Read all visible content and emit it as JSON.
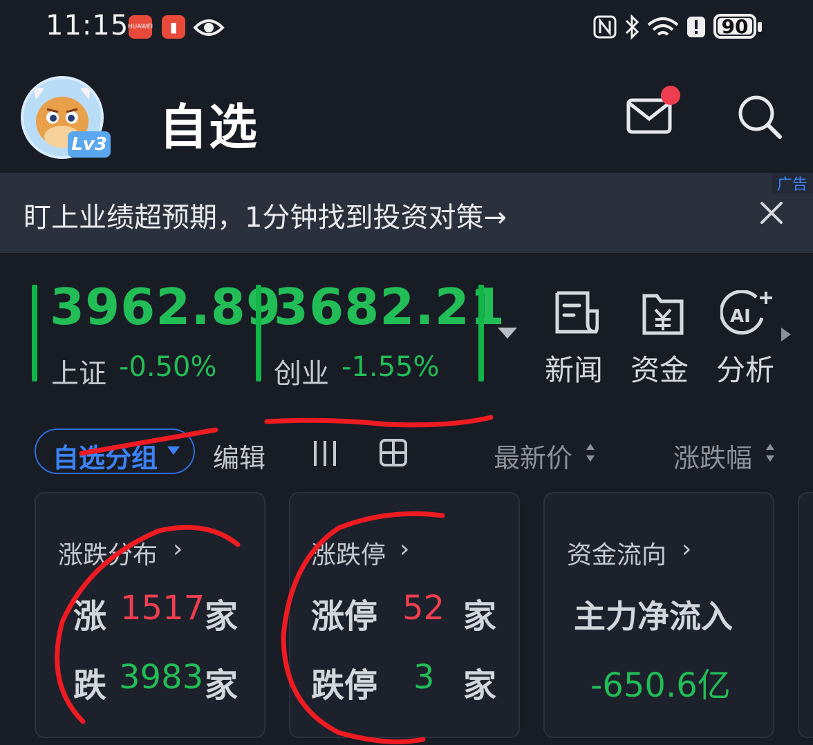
{
  "status_bar": {
    "time": "11:15",
    "battery": "90",
    "icons": [
      "huawei-app-icon",
      "notification-app-icon",
      "eye-icon",
      "nfc-icon",
      "bluetooth-icon",
      "wifi-icon",
      "alert-icon",
      "battery-icon"
    ]
  },
  "header": {
    "title": "自选",
    "avatar_level": "Lv3"
  },
  "ad": {
    "text": "盯上业绩超预期，1分钟找到投资对策→",
    "tag": "广告"
  },
  "indices": [
    {
      "value": "3962.89",
      "name": "上证",
      "change": "-0.50%"
    },
    {
      "value": "3682.21",
      "name": "创业",
      "change": "-1.55%"
    }
  ],
  "tools": [
    {
      "label": "新闻",
      "icon": "news-icon"
    },
    {
      "label": "资金",
      "icon": "money-icon"
    },
    {
      "label": "分析",
      "icon": "ai-analysis-icon"
    }
  ],
  "toolbar": {
    "group_label": "自选分组",
    "edit_label": "编辑",
    "latest_price_label": "最新价",
    "change_pct_label": "涨跌幅"
  },
  "cards": {
    "distribution": {
      "title": "涨跌分布",
      "up_label": "涨",
      "up_count": "1517",
      "up_unit": "家",
      "down_label": "跌",
      "down_count": "3983",
      "down_unit": "家"
    },
    "limit": {
      "title": "涨跌停",
      "up_label": "涨停",
      "up_count": "52",
      "up_unit": "家",
      "down_label": "跌停",
      "down_count": "3",
      "down_unit": "家"
    },
    "flow": {
      "title": "资金流向",
      "label": "主力净流入",
      "value": "-650.6亿"
    }
  },
  "colors": {
    "background": "#181c25",
    "up_red": "#ef3e4f",
    "down_green": "#22bd56",
    "accent_blue": "#3c82f6"
  }
}
